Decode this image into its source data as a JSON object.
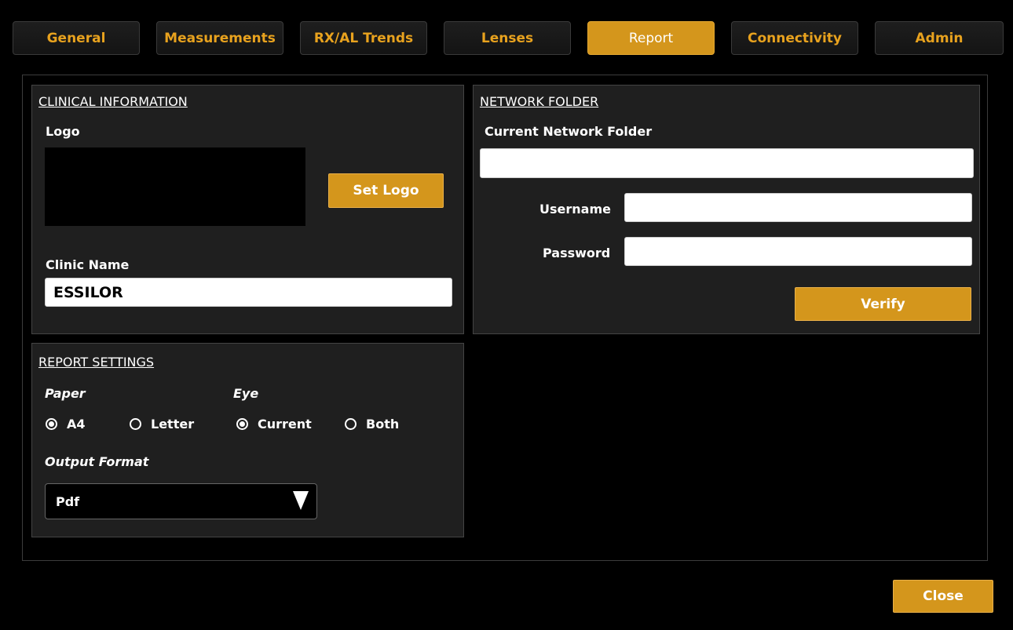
{
  "tabs": [
    "General",
    "Measurements",
    "RX/AL Trends",
    "Lenses",
    "Report",
    "Connectivity",
    "Admin"
  ],
  "active_tab": "Report",
  "clinical": {
    "title": "CLINICAL INFORMATION",
    "logo_label": "Logo",
    "set_logo_button": "Set Logo",
    "clinic_name_label": "Clinic Name",
    "clinic_name_value": "ESSILOR"
  },
  "network": {
    "title": "NETWORK FOLDER",
    "current_folder_label": "Current Network Folder",
    "current_folder_value": "",
    "username_label": "Username",
    "username_value": "",
    "password_label": "Password",
    "password_value": "",
    "verify_button": "Verify"
  },
  "report": {
    "title": "REPORT SETTINGS",
    "paper_label": "Paper",
    "paper_options": [
      "A4",
      "Letter"
    ],
    "paper_selected": "A4",
    "eye_label": "Eye",
    "eye_options": [
      "Current",
      "Both"
    ],
    "eye_selected": "Current",
    "output_format_label": "Output Format",
    "output_format_value": "Pdf"
  },
  "close_button": "Close",
  "colors": {
    "accent": "#d4961c",
    "tab_text": "#e8a21e",
    "panel_bg": "#1f1f1f",
    "background": "#000000"
  }
}
